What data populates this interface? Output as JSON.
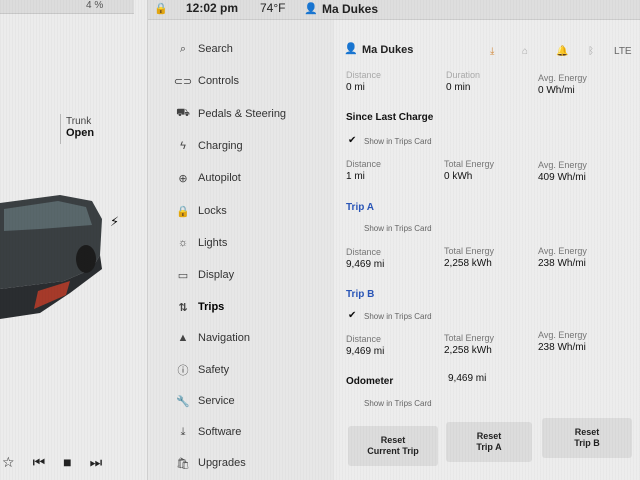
{
  "status_bar": {
    "battery_pct": "4 %",
    "time": "12:02 pm",
    "temperature": "74°F",
    "profile": "Ma Dukes"
  },
  "left_panel": {
    "trunk_label": "Trunk",
    "trunk_status": "Open"
  },
  "menu": {
    "items": [
      {
        "label": "Search",
        "icon": "search-icon"
      },
      {
        "label": "Controls",
        "icon": "toggle-icon"
      },
      {
        "label": "Pedals & Steering",
        "icon": "car-icon"
      },
      {
        "label": "Charging",
        "icon": "bolt-icon"
      },
      {
        "label": "Autopilot",
        "icon": "steering-wheel-icon"
      },
      {
        "label": "Locks",
        "icon": "lock-icon"
      },
      {
        "label": "Lights",
        "icon": "sun-icon"
      },
      {
        "label": "Display",
        "icon": "display-icon"
      },
      {
        "label": "Trips",
        "icon": "trips-icon"
      },
      {
        "label": "Navigation",
        "icon": "navigation-icon"
      },
      {
        "label": "Safety",
        "icon": "safety-icon"
      },
      {
        "label": "Service",
        "icon": "wrench-icon"
      },
      {
        "label": "Software",
        "icon": "download-icon"
      },
      {
        "label": "Upgrades",
        "icon": "bag-icon"
      }
    ],
    "active": "Trips"
  },
  "content": {
    "profile_name": "Ma Dukes",
    "current": {
      "distance_label": "Distance",
      "distance_value": "0 mi",
      "duration_label": "Duration",
      "duration_value": "0 min",
      "energy_label": "Avg. Energy",
      "energy_value": "0 Wh/mi"
    },
    "since_last_charge": {
      "title": "Since Last Charge",
      "show_label": "Show in Trips Card",
      "checked": true,
      "distance_label": "Distance",
      "distance_value": "1 mi",
      "total_label": "Total Energy",
      "total_value": "0 kWh",
      "avg_label": "Avg. Energy",
      "avg_value": "409 Wh/mi"
    },
    "trip_a": {
      "title": "Trip A",
      "show_label": "Show in Trips Card",
      "checked": false,
      "distance_label": "Distance",
      "distance_value": "9,469 mi",
      "total_label": "Total Energy",
      "total_value": "2,258 kWh",
      "avg_label": "Avg. Energy",
      "avg_value": "238 Wh/mi"
    },
    "trip_b": {
      "title": "Trip B",
      "show_label": "Show in Trips Card",
      "checked": true,
      "distance_label": "Distance",
      "distance_value": "9,469 mi",
      "total_label": "Total Energy",
      "total_value": "2,258 kWh",
      "avg_label": "Avg. Energy",
      "avg_value": "238 Wh/mi"
    },
    "odometer": {
      "label": "Odometer",
      "value": "9,469 mi",
      "show_label": "Show in Trips Card",
      "checked": false
    },
    "buttons": {
      "reset_current_line1": "Reset",
      "reset_current_line2": "Current Trip",
      "reset_a_line1": "Reset",
      "reset_a_line2": "Trip A",
      "reset_b_line1": "Reset",
      "reset_b_line2": "Trip B"
    }
  }
}
